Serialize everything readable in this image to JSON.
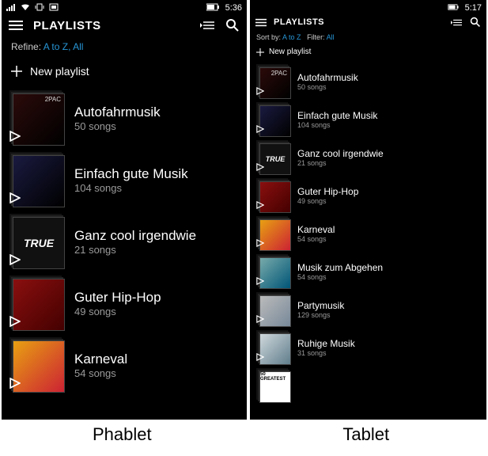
{
  "labels": {
    "left": "Phablet",
    "right": "Tablet"
  },
  "phablet": {
    "status": {
      "time": "5:36"
    },
    "header": {
      "title": "PLAYLISTS"
    },
    "refine": {
      "label": "Refine:",
      "sort": "A to Z",
      "sep": ",",
      "filter": "All"
    },
    "newPlaylist": "New playlist",
    "items": [
      {
        "title": "Autofahrmusik",
        "sub": "50 songs"
      },
      {
        "title": "Einfach gute Musik",
        "sub": "104 songs"
      },
      {
        "title": "Ganz cool irgendwie",
        "sub": "21 songs"
      },
      {
        "title": "Guter Hip-Hop",
        "sub": "49 songs"
      },
      {
        "title": "Karneval",
        "sub": "54 songs"
      }
    ],
    "trueLabel": "TRUE"
  },
  "tablet": {
    "status": {
      "time": "5:17"
    },
    "header": {
      "title": "PLAYLISTS"
    },
    "refine": {
      "sortLabel": "Sort by:",
      "sort": "A to Z",
      "filterLabel": "Filter:",
      "filter": "All"
    },
    "newPlaylist": "New playlist",
    "items": [
      {
        "title": "Autofahrmusik",
        "sub": "50 songs"
      },
      {
        "title": "Einfach gute Musik",
        "sub": "104 songs"
      },
      {
        "title": "Ganz cool irgendwie",
        "sub": "21 songs"
      },
      {
        "title": "Guter Hip-Hop",
        "sub": "49 songs"
      },
      {
        "title": "Karneval",
        "sub": "54 songs"
      },
      {
        "title": "Musik zum Abgehen",
        "sub": "54 songs"
      },
      {
        "title": "Partymusik",
        "sub": "129 songs"
      },
      {
        "title": "Ruhige Musik",
        "sub": "31 songs"
      }
    ],
    "trueLabel": "TRUE",
    "lastCover": "50 GREATEST"
  }
}
